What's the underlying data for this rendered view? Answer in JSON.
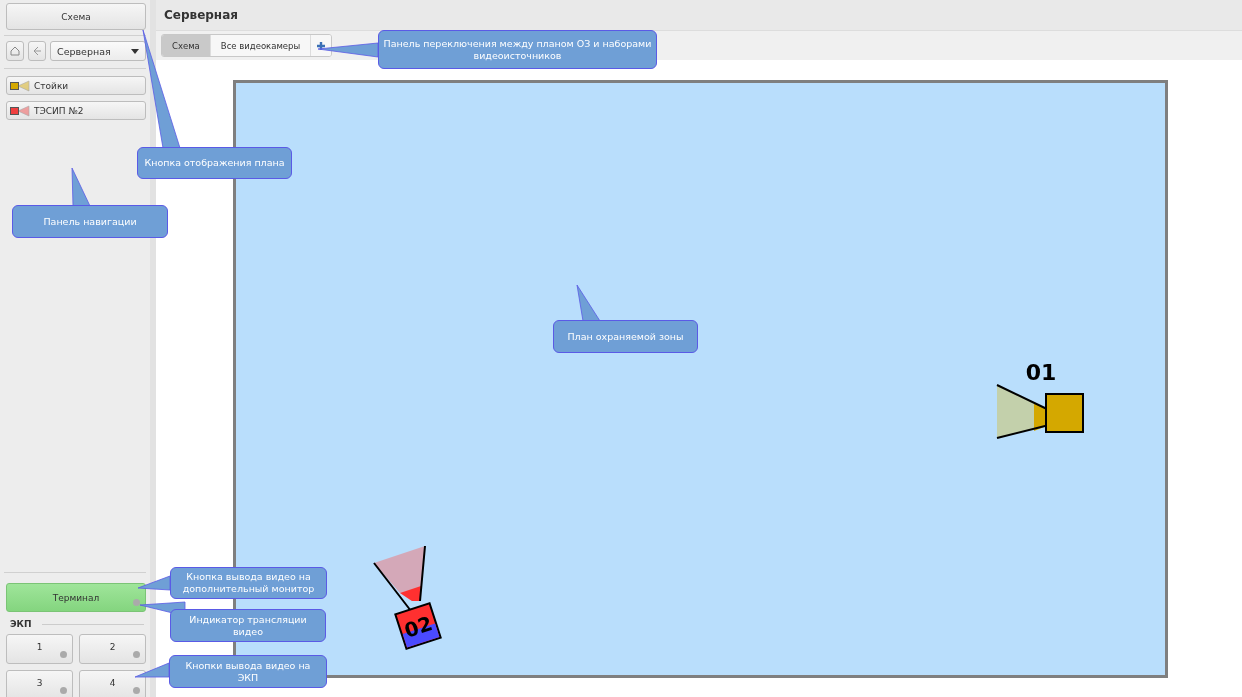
{
  "sidebar": {
    "plan_button": "Схема",
    "location_dropdown": "Серверная",
    "items": [
      {
        "label": "Стойки",
        "color": "#d4a800"
      },
      {
        "label": "ТЭСИП №2",
        "color": "#f04040"
      }
    ],
    "terminal": {
      "label": "Терминал",
      "on": true
    },
    "ekp": {
      "title": "ЭКП",
      "buttons": [
        "1",
        "2",
        "3",
        "4"
      ]
    }
  },
  "main": {
    "title": "Серверная",
    "tabs": [
      {
        "label": "Схема",
        "selected": true
      },
      {
        "label": "Все видеокамеры",
        "selected": false
      }
    ],
    "plan": {
      "cameras": [
        {
          "label": "01",
          "color": "#d4a800"
        },
        {
          "label": "02",
          "color": "#ff3030"
        }
      ]
    }
  },
  "callouts": [
    "Кнопка отображения плана",
    "Панель навигации",
    "Панель переключения между планом ОЗ и наборами видеоисточников",
    "План охраняемой зоны",
    "Кнопка вывода видео на дополнительный монитор",
    "Индикатор трансляции видео",
    "Кнопки вывода видео на ЭКП"
  ]
}
